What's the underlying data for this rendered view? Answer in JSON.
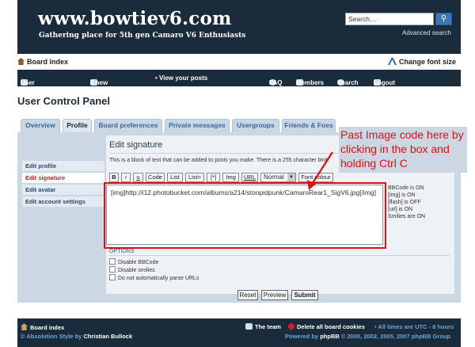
{
  "header": {
    "site_title": "www.bowtiev6.com",
    "site_description": "Gathering place for 5th gen Camaro V6 Enthusiasts",
    "search_placeholder": "Search…",
    "advanced_search": "Advanced search"
  },
  "breadcrumb": {
    "home": "Board index",
    "change_font": "Change font size"
  },
  "navbar": {
    "ucp": "User Control Panel",
    "messages": "0 new messages",
    "view_posts": "• View your posts",
    "faq": "FAQ",
    "members": "Members",
    "search": "Search",
    "logout": "Logout [ Demon Hunter ]"
  },
  "page_title": "User Control Panel",
  "tabs": [
    "Overview",
    "Profile",
    "Board preferences",
    "Private messages",
    "Usergroups",
    "Friends & Foes"
  ],
  "active_tab": "Profile",
  "sidebar": [
    "Edit profile",
    "Edit signature",
    "Edit avatar",
    "Edit account settings"
  ],
  "active_sidebar": "Edit signature",
  "editor": {
    "title": "Edit signature",
    "description": "This is a block of text that can be added to posts you make. There is a 255 character limit.",
    "buttons": [
      "B",
      "i",
      "u",
      "Code",
      "List",
      "List=",
      "[*]",
      "Img",
      "URL"
    ],
    "font_size": "Normal",
    "font_colour": "Font colour",
    "signature_value": "[img]http://i12.photobucket.com/albums/a214/stoopidpunk/CamaroRear1_SigV6.jpg[/img]",
    "status": [
      "BBCode is ON",
      "[img] is ON",
      "[flash] is OFF",
      "[url] is ON",
      "Smilies are ON"
    ]
  },
  "options": {
    "title": "OPTIONS",
    "items": [
      "Disable BBCode",
      "Disable smilies",
      "Do not automatically parse URLs"
    ]
  },
  "actions": {
    "reset": "Reset",
    "preview": "Preview",
    "submit": "Submit"
  },
  "annotation": "Past Image code here by clicking in the box and holding Ctrl C",
  "footer": {
    "board_index": "Board index",
    "team": "The team",
    "delete_cookies": "Delete all board cookies",
    "timezone": "• All times are UTC - 8 hours",
    "style_credit": "© Absolution Style by",
    "style_author": "Christian Bullock",
    "powered_by": "Powered by",
    "phpbb": "phpBB",
    "copyright": "© 2000, 2002, 2005, 2007 phpBB Group"
  },
  "colors": {
    "header_bg": "#1a2b3c",
    "panel_bg": "#cbd8e4",
    "annotation": "#e01010",
    "active_menu": "#c02020"
  }
}
